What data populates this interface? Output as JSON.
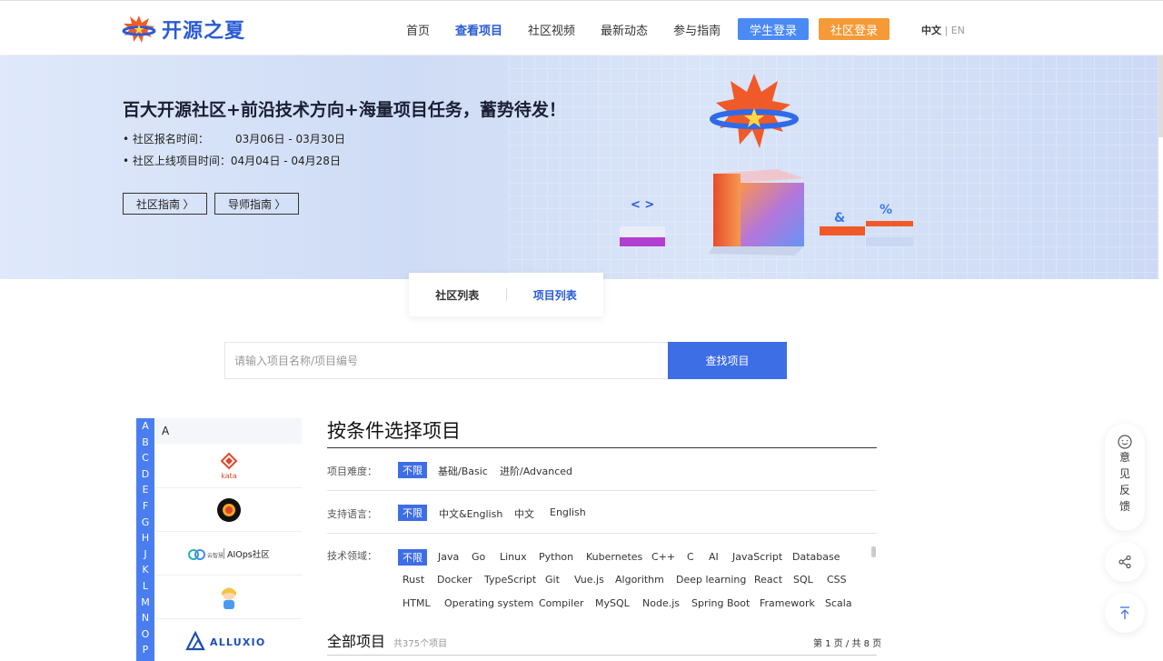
{
  "header": {
    "logo_text": "开源之夏",
    "nav": [
      {
        "label": "首页",
        "active": false
      },
      {
        "label": "查看项目",
        "active": true
      },
      {
        "label": "社区视频",
        "active": false
      },
      {
        "label": "最新动态",
        "active": false
      },
      {
        "label": "参与指南",
        "active": false
      }
    ],
    "student_login": "学生登录",
    "community_login": "社区登录",
    "lang_current": "中文",
    "lang_sep": "|",
    "lang_other": "EN"
  },
  "banner": {
    "title": "百大开源社区+前沿技术方向+海量项目任务，蓄势待发！",
    "reg_label": "• 社区报名时间：",
    "reg_value": "03月06日 - 03月30日",
    "online_label": "• 社区上线项目时间：",
    "online_value": "04月04日 - 04月28日",
    "btn_guide": "社区指南 〉",
    "btn_mentor": "导师指南 〉",
    "deco_code": "< >",
    "deco_amp": "&",
    "deco_pct": "%"
  },
  "tabs": {
    "community_list": "社区列表",
    "project_list": "项目列表"
  },
  "search": {
    "placeholder": "请输入项目名称/项目编号",
    "button": "查找项目"
  },
  "alphabet": [
    "A",
    "B",
    "C",
    "D",
    "E",
    "F",
    "G",
    "H",
    "J",
    "K",
    "L",
    "M",
    "N",
    "O",
    "P"
  ],
  "community_index": {
    "current_letter": "A",
    "aiops_name": "AIOps社区",
    "aiops_brand": "云智慧",
    "kata_text": "kata",
    "alluxio_text": "ALLUXIO"
  },
  "filters": {
    "title": "按条件选择项目",
    "difficulty": {
      "label": "项目难度：",
      "options": [
        "不限",
        "基础/Basic",
        "进阶/Advanced"
      ]
    },
    "language": {
      "label": "支持语言：",
      "options": [
        "不限",
        "中文&English",
        "中文",
        "English"
      ]
    },
    "tech": {
      "label": "技术领域：",
      "row1": [
        "不限",
        "Java",
        "Go",
        "Linux",
        "Python",
        "Kubernetes",
        "C++",
        "C",
        "AI",
        "JavaScript",
        "Database"
      ],
      "row2": [
        "Rust",
        "Docker",
        "TypeScript",
        "Git",
        "Vue.js",
        "Algorithm",
        "Deep learning",
        "React",
        "SQL",
        "CSS"
      ],
      "row3": [
        "HTML",
        "Operating system",
        "Compiler",
        "MySQL",
        "Node.js",
        "Spring Boot",
        "Framework",
        "Scala"
      ]
    }
  },
  "all_projects": {
    "title": "全部项目",
    "count": "共375个项目",
    "pager": "第 1 页 / 共 8 页"
  },
  "float": {
    "feedback_chars": [
      "意",
      "见",
      "反",
      "馈"
    ]
  }
}
